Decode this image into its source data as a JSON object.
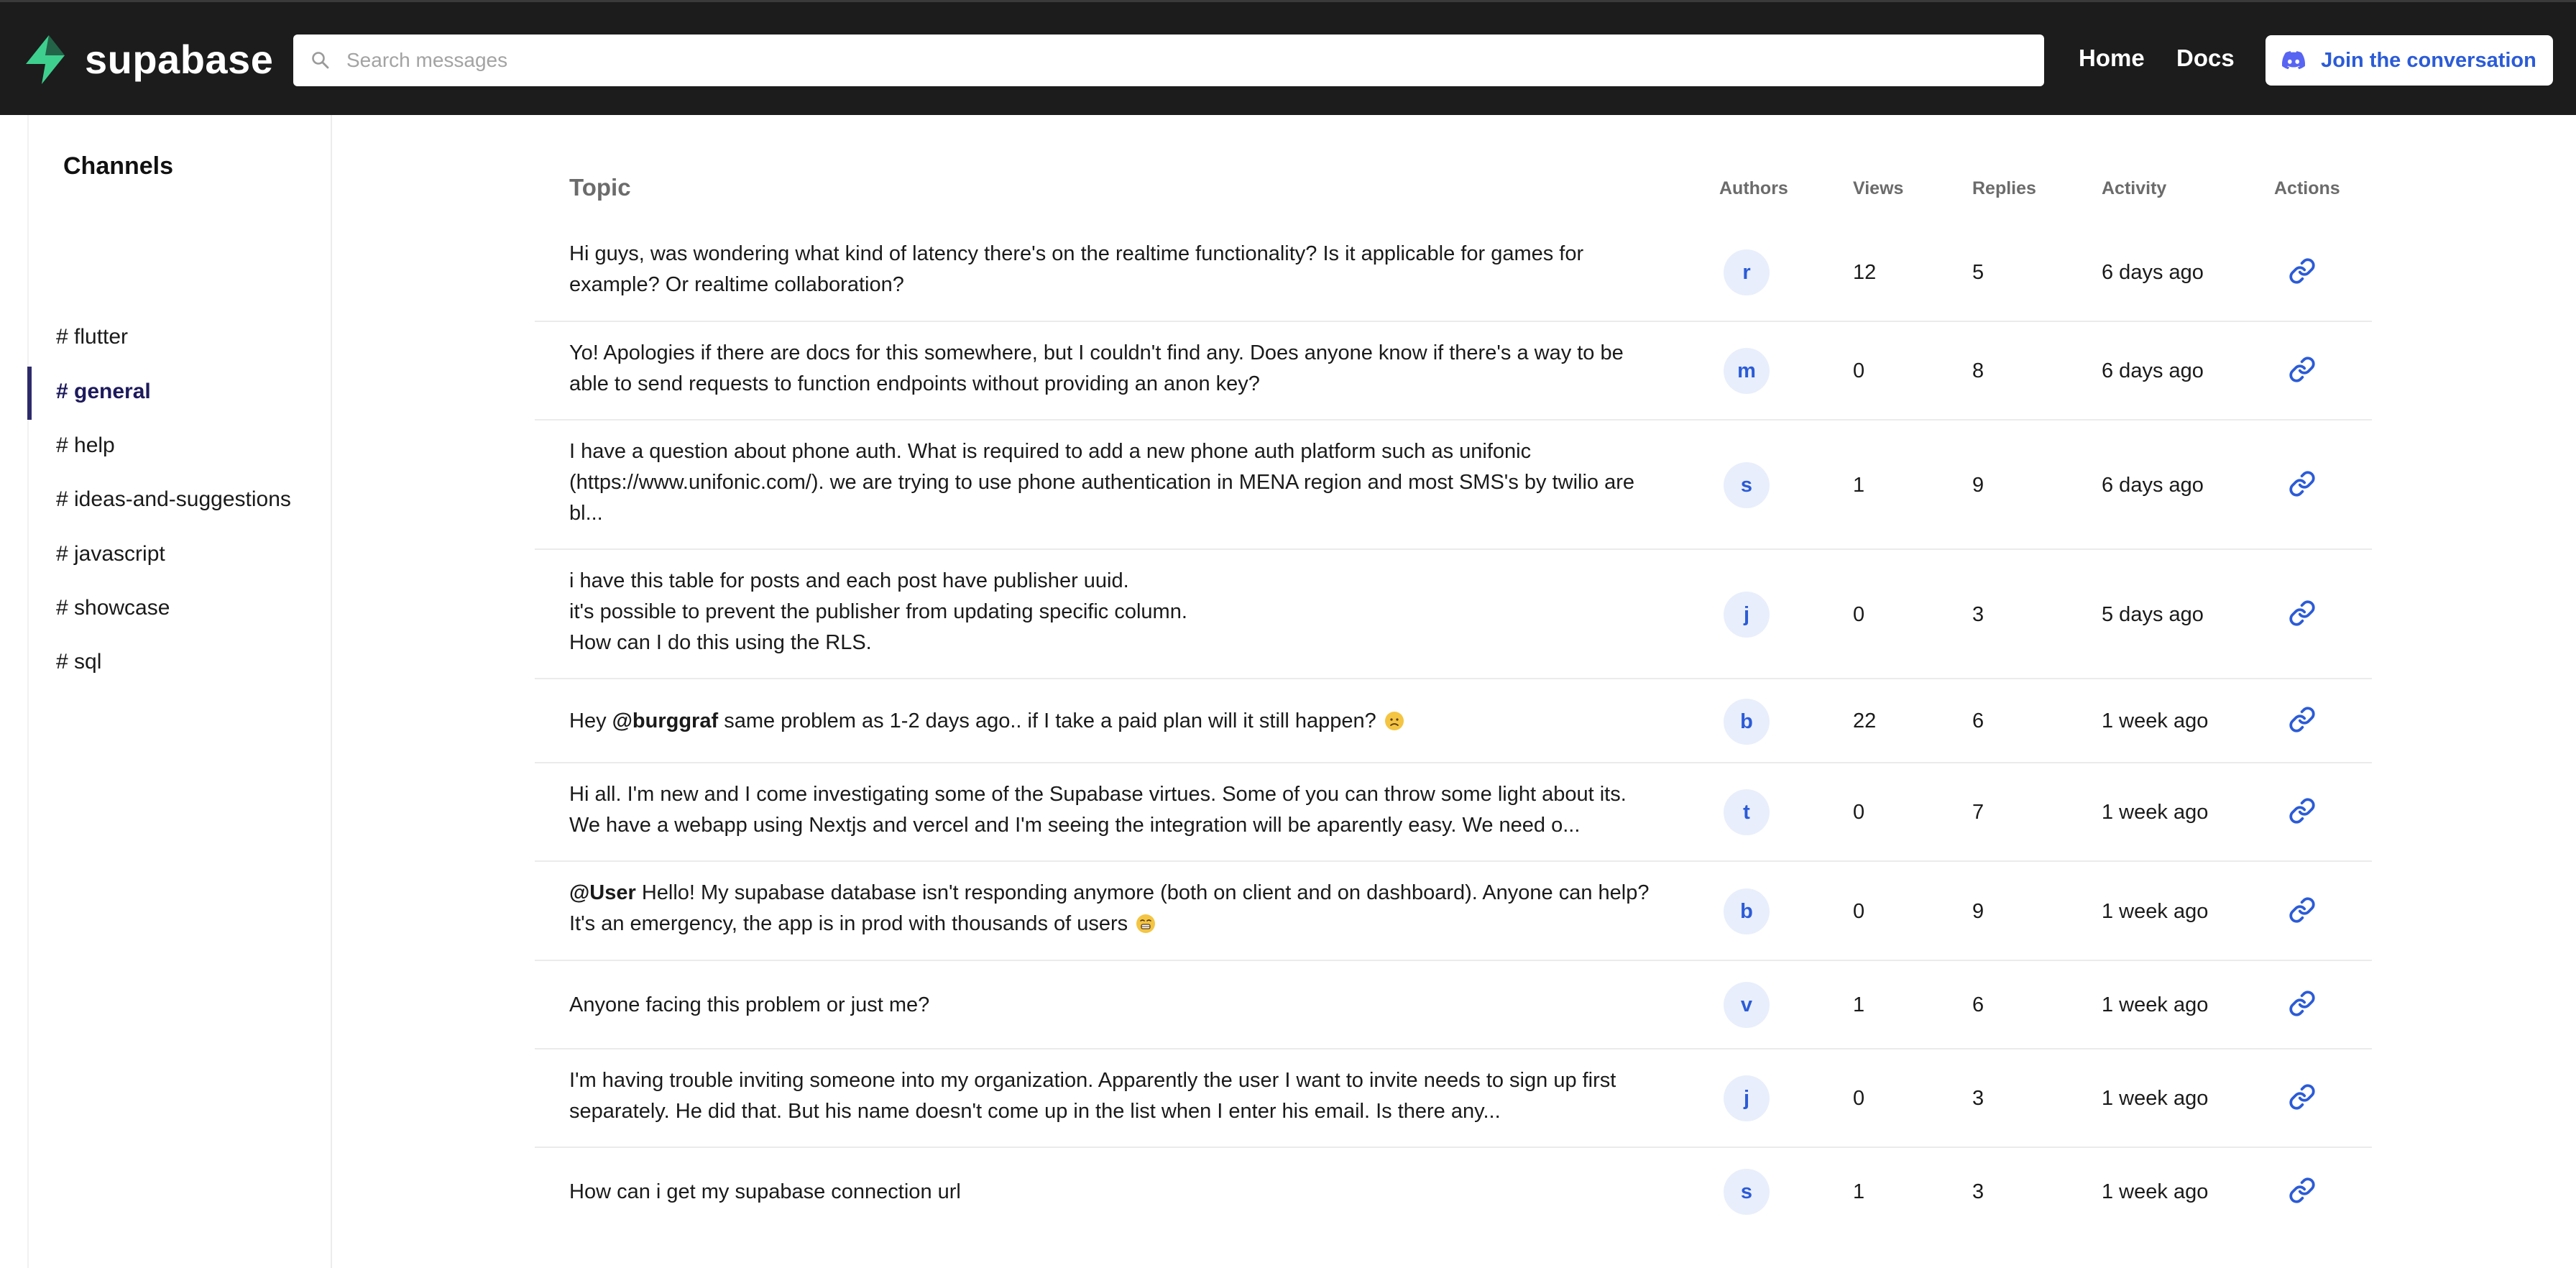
{
  "header": {
    "logo_text": "supabase",
    "search_placeholder": "Search messages",
    "nav": {
      "home_label": "Home",
      "docs_label": "Docs"
    },
    "join_label": "Join the conversation"
  },
  "sidebar": {
    "title": "Channels",
    "channels": [
      {
        "label": "# flutter",
        "active": false
      },
      {
        "label": "# general",
        "active": true
      },
      {
        "label": "# help",
        "active": false
      },
      {
        "label": "# ideas-and-suggestions",
        "active": false
      },
      {
        "label": "# javascript",
        "active": false
      },
      {
        "label": "# showcase",
        "active": false
      },
      {
        "label": "# sql",
        "active": false
      }
    ]
  },
  "table": {
    "columns": {
      "topic": "Topic",
      "authors": "Authors",
      "views": "Views",
      "replies": "Replies",
      "activity": "Activity",
      "actions": "Actions"
    },
    "rows": [
      {
        "topic_lines": [
          "Hi guys, was wondering what kind of latency there's on the realtime functionality? Is it applicable for games for",
          "example? Or realtime collaboration?"
        ],
        "author": "r",
        "views": "12",
        "replies": "5",
        "activity": "6 days ago"
      },
      {
        "topic_lines": [
          "Yo! Apologies if there are docs for this somewhere, but I couldn't find any. Does anyone know if there's a way to be",
          "able to send requests to function endpoints without providing an anon key?"
        ],
        "author": "m",
        "views": "0",
        "replies": "8",
        "activity": "6 days ago"
      },
      {
        "topic_lines": [
          "I have a question about phone auth. What is required to add a new phone auth platform such as unifonic",
          "(https://www.unifonic.com/). we are trying to use phone authentication in MENA region and most SMS's by twilio are",
          "bl..."
        ],
        "author": "s",
        "views": "1",
        "replies": "9",
        "activity": "6 days ago"
      },
      {
        "topic_lines": [
          "i have this table for posts and each post have publisher uuid.",
          "it's possible to prevent the publisher from updating specific column.",
          "How can I do this using the RLS."
        ],
        "author": "j",
        "views": "0",
        "replies": "3",
        "activity": "5 days ago"
      },
      {
        "topic_prefix": "Hey ",
        "topic_mention": "@burggraf",
        "topic_suffix": " same problem as 1-2 days ago.. if I take a paid plan will it still happen?",
        "emoji": "disappointed-face",
        "author": "b",
        "views": "22",
        "replies": "6",
        "activity": "1 week ago"
      },
      {
        "topic_lines": [
          "Hi all. I'm new and I come investigating some of the Supabase virtues. Some of you can throw some light about its.",
          "We have a webapp using Nextjs and vercel and I'm seeing the integration will be aparently easy. We need o..."
        ],
        "author": "t",
        "views": "0",
        "replies": "7",
        "activity": "1 week ago"
      },
      {
        "topic_mention": "@User",
        "topic_line1_rest": " Hello! My supabase database isn't responding anymore (both on client and on dashboard). Anyone can help?",
        "topic_line2": "It's an emergency, the app is in prod with thousands of users",
        "emoji": "grimacing-face",
        "author": "b",
        "views": "0",
        "replies": "9",
        "activity": "1 week ago"
      },
      {
        "topic_lines": [
          "Anyone facing this problem or just me?"
        ],
        "author": "v",
        "views": "1",
        "replies": "6",
        "activity": "1 week ago"
      },
      {
        "topic_lines": [
          "I'm having trouble inviting someone into my organization. Apparently the user I want to invite needs to sign up first",
          "separately. He did that. But his name doesn't come up in the list when I enter his email. Is there any..."
        ],
        "author": "j",
        "views": "0",
        "replies": "3",
        "activity": "1 week ago"
      },
      {
        "topic_lines": [
          "How can i get my supabase connection url"
        ],
        "author": "s",
        "views": "1",
        "replies": "3",
        "activity": "1 week ago"
      }
    ]
  },
  "colors": {
    "header_bg": "#1c1c1c",
    "brand_green": "#3ecf8e",
    "link_blue": "#2b5bd7",
    "active_channel": "#2d2a6b",
    "avatar_bg": "#e8eefb"
  }
}
